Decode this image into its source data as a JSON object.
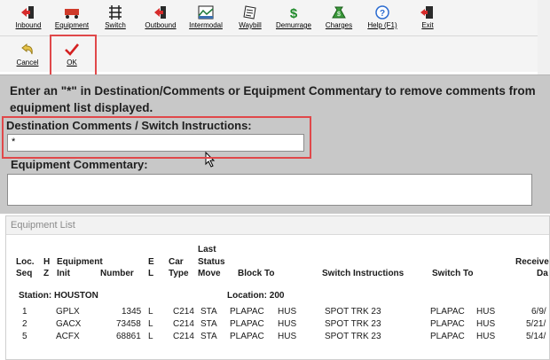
{
  "toolbar": {
    "buttons": [
      {
        "label": "Inbound",
        "icon": "inbound-icon"
      },
      {
        "label": "Equipment",
        "icon": "equipment-icon"
      },
      {
        "label": "Switch",
        "icon": "switch-icon"
      },
      {
        "label": "Outbound",
        "icon": "outbound-icon"
      },
      {
        "label": "Intermodal",
        "icon": "intermodal-icon"
      },
      {
        "label": "Waybill",
        "icon": "waybill-icon"
      },
      {
        "label": "Demurrage",
        "icon": "demurrage-icon"
      },
      {
        "label": "Charges",
        "icon": "charges-icon"
      },
      {
        "label": "Help (F1)",
        "icon": "help-icon"
      },
      {
        "label": "Exit",
        "icon": "exit-icon"
      }
    ],
    "cancel_label": "Cancel",
    "ok_label": "OK"
  },
  "panel": {
    "instruction": "Enter an \"*\" in Destination/Comments or Equipment Commentary to remove comments from equipment list displayed.",
    "dest_label": "Destination Comments / Switch Instructions:",
    "dest_value": "*",
    "commentary_label": "Equipment Commentary:",
    "commentary_value": ""
  },
  "equipment_list": {
    "title": "Equipment List",
    "headers": {
      "loc": "Loc.",
      "seq": "Seq",
      "h": "H",
      "z": "Z",
      "equipment": "Equipment",
      "init": "Init",
      "number": "Number",
      "e": "E",
      "l": "L",
      "car": "Car",
      "type": "Type",
      "last": "Last",
      "status": "Status",
      "move": "Move",
      "block_to": "Block To",
      "switch_instructions": "Switch Instructions",
      "switch_to": "Switch To",
      "received": "Receive",
      "received_sub": "Da"
    },
    "station_label": "Station: HOUSTON",
    "location_label": "Location: 200",
    "rows": [
      {
        "seq": "1",
        "init": "GPLX",
        "number": "1345",
        "el": "L",
        "type": "C214",
        "move": "STA",
        "block1": "PLAPAC",
        "block2": "HUS",
        "instr": "SPOT TRK 23",
        "sw1": "PLAPAC",
        "sw2": "HUS",
        "recv": "6/9/"
      },
      {
        "seq": "2",
        "init": "GACX",
        "number": "73458",
        "el": "L",
        "type": "C214",
        "move": "STA",
        "block1": "PLAPAC",
        "block2": "HUS",
        "instr": "SPOT TRK 23",
        "sw1": "PLAPAC",
        "sw2": "HUS",
        "recv": "5/21/"
      },
      {
        "seq": "5",
        "init": "ACFX",
        "number": "68861",
        "el": "L",
        "type": "C214",
        "move": "STA",
        "block1": "PLAPAC",
        "block2": "HUS",
        "instr": "SPOT TRK 23",
        "sw1": "PLAPAC",
        "sw2": "HUS",
        "recv": "5/14/"
      }
    ]
  },
  "colors": {
    "highlight": "#e0484a",
    "panel": "#c8c8c8"
  }
}
